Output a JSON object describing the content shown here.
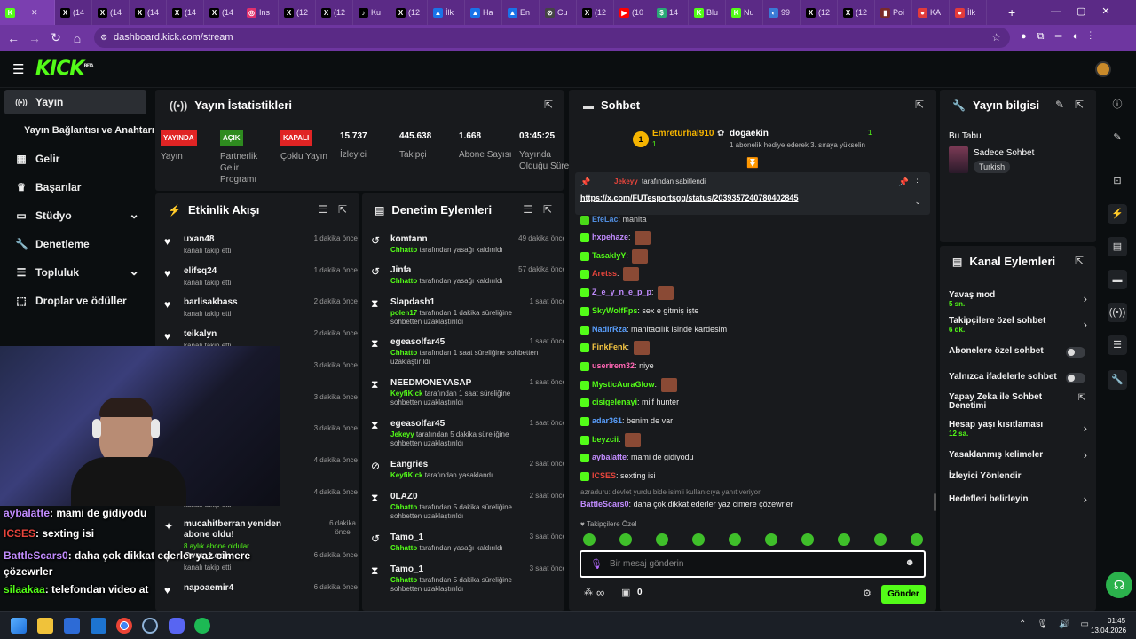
{
  "browser": {
    "tabs": [
      {
        "fav": "K",
        "color": "#53fc18",
        "label": ""
      },
      {
        "fav": "X",
        "color": "#000000",
        "label": "(14"
      },
      {
        "fav": "X",
        "color": "#000000",
        "label": "(14"
      },
      {
        "fav": "X",
        "color": "#000000",
        "label": "(14"
      },
      {
        "fav": "X",
        "color": "#000000",
        "label": "(14"
      },
      {
        "fav": "X",
        "color": "#000000",
        "label": "(14"
      },
      {
        "fav": "◎",
        "color": "#e1306c",
        "label": "Ins"
      },
      {
        "fav": "X",
        "color": "#000000",
        "label": "(12"
      },
      {
        "fav": "X",
        "color": "#000000",
        "label": "(12"
      },
      {
        "fav": "♪",
        "color": "#000000",
        "label": "Ku"
      },
      {
        "fav": "X",
        "color": "#000000",
        "label": "(12"
      },
      {
        "fav": "▲",
        "color": "#1a73e8",
        "label": "İlk"
      },
      {
        "fav": "▲",
        "color": "#1a73e8",
        "label": "Ha"
      },
      {
        "fav": "▲",
        "color": "#1a73e8",
        "label": "En"
      },
      {
        "fav": "⊘",
        "color": "#444444",
        "label": "Cu"
      },
      {
        "fav": "X",
        "color": "#000000",
        "label": "(12"
      },
      {
        "fav": "▶",
        "color": "#ff0000",
        "label": "(10"
      },
      {
        "fav": "$",
        "color": "#2aa876",
        "label": "14"
      },
      {
        "fav": "K",
        "color": "#53fc18",
        "label": "Blu"
      },
      {
        "fav": "K",
        "color": "#53fc18",
        "label": "Nu"
      },
      {
        "fav": "◐",
        "color": "#3a7bd5",
        "label": "99"
      },
      {
        "fav": "X",
        "color": "#000000",
        "label": "(12"
      },
      {
        "fav": "X",
        "color": "#000000",
        "label": "(12"
      },
      {
        "fav": "▮",
        "color": "#7a2a2a",
        "label": "Poi"
      },
      {
        "fav": "●",
        "color": "#e23b3b",
        "label": "KA"
      },
      {
        "fav": "●",
        "color": "#e23b3b",
        "label": "İlk"
      }
    ],
    "url": "dashboard.kick.com/stream"
  },
  "sidebar": {
    "items": [
      {
        "icon": "((•))",
        "label": "Yayın"
      },
      {
        "icon": "",
        "label": "Yayın Bağlantısı ve Anahtarı"
      },
      {
        "icon": "▦",
        "label": "Gelir"
      },
      {
        "icon": "♛",
        "label": "Başarılar"
      },
      {
        "icon": "▭",
        "label": "Stüdyo"
      },
      {
        "icon": "🔧",
        "label": "Denetleme"
      },
      {
        "icon": "☰",
        "label": "Topluluk"
      },
      {
        "icon": "⬚",
        "label": "Droplar ve ödüller"
      }
    ]
  },
  "stats": {
    "title": "Yayın İstatistikleri",
    "items": [
      {
        "badge": "YAYINDA",
        "badge_color": "#e02424",
        "label": "Yayın"
      },
      {
        "badge": "AÇIK",
        "badge_color": "#2e8b1f",
        "label": "Partnerlik Gelir Programı"
      },
      {
        "badge": "KAPALI",
        "badge_color": "#e02424",
        "label": "Çoklu Yayın"
      },
      {
        "value": "15.737",
        "label": "İzleyici"
      },
      {
        "value": "445.638",
        "label": "Takipçi"
      },
      {
        "value": "1.668",
        "label": "Abone Sayısı"
      },
      {
        "value": "03:45:25",
        "label": "Yayında Olduğu Süre"
      }
    ]
  },
  "activity": {
    "title": "Etkinlik Akışı",
    "rows": [
      {
        "name": "uxan48",
        "sub": "kanalı takip etti",
        "time": "1 dakika önce"
      },
      {
        "name": "elifsq24",
        "sub": "kanalı takip etti",
        "time": "1 dakika önce"
      },
      {
        "name": "barlisakbass",
        "sub": "kanalı takip etti",
        "time": "2 dakika önce"
      },
      {
        "name": "teikalyn",
        "sub": "kanalı takip etti",
        "time": "2 dakika önce"
      },
      {
        "name": "",
        "sub": "",
        "time": "3 dakika önce"
      },
      {
        "name": "",
        "sub": "",
        "time": "3 dakika önce"
      },
      {
        "name": "",
        "sub": "",
        "time": "3 dakika önce"
      },
      {
        "name": "",
        "sub": "",
        "time": "4 dakika önce"
      },
      {
        "name": "",
        "sub": "kanalı takip etti",
        "time": "4 dakika önce"
      },
      {
        "name": "mucahitberran yeniden abone oldu!",
        "sub": "8 aylık abone oldular",
        "time": "6 dakika önce"
      },
      {
        "name": "Over_Lock",
        "sub": "kanalı takip etti",
        "time": "6 dakika önce"
      },
      {
        "name": "napoaemir4",
        "sub": "",
        "time": "6 dakika önce"
      }
    ]
  },
  "moderation": {
    "title": "Denetim Eylemleri",
    "rows": [
      {
        "name": "komtann",
        "actor": "Chhatto",
        "sub": "tarafından yasağı kaldırıldı",
        "time": "49 dakika önce",
        "icon": "↺"
      },
      {
        "name": "Jinfa",
        "actor": "Chhatto",
        "sub": "tarafından yasağı kaldırıldı",
        "time": "57 dakika önce",
        "icon": "↺"
      },
      {
        "name": "Slapdash1",
        "actor": "polen17",
        "sub": "tarafından 1 dakika süreliğine sohbetten uzaklaştırıldı",
        "time": "1 saat önce",
        "icon": "⧗"
      },
      {
        "name": "egeasolfar45",
        "actor": "Chhatto",
        "sub": "tarafından 1 saat süreliğine sohbetten uzaklaştırıldı",
        "time": "1 saat önce",
        "icon": "⧗"
      },
      {
        "name": "NEEDMONEYASAP",
        "actor": "KeyfiKick",
        "sub": "tarafından 1 saat süreliğine sohbetten uzaklaştırıldı",
        "time": "1 saat önce",
        "icon": "⧗"
      },
      {
        "name": "egeasolfar45",
        "actor": "Jekeyy",
        "sub": "tarafından 5 dakika süreliğine sohbetten uzaklaştırıldı",
        "time": "1 saat önce",
        "icon": "⧗"
      },
      {
        "name": "Eangries",
        "actor": "KeyfiKick",
        "sub": "tarafından yasaklandı",
        "time": "2 saat önce",
        "icon": "⊘"
      },
      {
        "name": "0LAZ0",
        "actor": "Chhatto",
        "sub": "tarafından 5 dakika süreliğine sohbetten uzaklaştırıldı",
        "time": "2 saat önce",
        "icon": "⧗"
      },
      {
        "name": "Tamo_1",
        "actor": "Chhatto",
        "sub": "tarafından yasağı kaldırıldı",
        "time": "3 saat önce",
        "icon": "↺"
      },
      {
        "name": "Tamo_1",
        "actor": "Chhatto",
        "sub": "tarafından 5 dakika süreliğine sohbetten uzaklaştırıldı",
        "time": "3 saat önce",
        "icon": "⧗"
      }
    ]
  },
  "chat": {
    "title": "Sohbet",
    "top_gifter": {
      "rank": "1",
      "name": "Emreturhal910",
      "count": "1"
    },
    "gift_user": {
      "name": "dogaekin",
      "count": "1",
      "text": "1 abonelik hediye ederek 3. sıraya yükselin"
    },
    "pinned": {
      "by": "Jekeyy",
      "label": "tarafından sabitlendi",
      "url": "https://x.com/FUTesportsgg/status/2039357240780402845"
    },
    "messages": [
      {
        "user": "EfeLac",
        "color": "#5aa0ff",
        "text": "manita",
        "emote": false
      },
      {
        "user": "hxpehaze",
        "color": "#c28cff",
        "text": "",
        "emote": true
      },
      {
        "user": "TasaklyY",
        "color": "#53fc18",
        "text": "",
        "emote": true
      },
      {
        "user": "Aretss",
        "color": "#e8453c",
        "text": "",
        "emote": true
      },
      {
        "user": "Z_e_y_n_e_p_p",
        "color": "#c28cff",
        "text": "",
        "emote": true
      },
      {
        "user": "SkyWolfFps",
        "color": "#53fc18",
        "text": "sex e gitmiş işte",
        "emote": false
      },
      {
        "user": "NadirRza",
        "color": "#5aa0ff",
        "text": "manitacılık isinde kardesim",
        "emote": false
      },
      {
        "user": "FinkFenk",
        "color": "#f5c542",
        "text": "",
        "emote": true
      },
      {
        "user": "userirem32",
        "color": "#ff66b3",
        "text": "niye",
        "emote": false
      },
      {
        "user": "MysticAuraGlow",
        "color": "#53fc18",
        "text": "",
        "emote": true
      },
      {
        "user": "cisigelenayi",
        "color": "#53fc18",
        "text": "milf hunter",
        "emote": false
      },
      {
        "user": "adar361",
        "color": "#5aa0ff",
        "text": "benim de var",
        "emote": false
      },
      {
        "user": "beyzcii",
        "color": "#53fc18",
        "text": "",
        "emote": true
      },
      {
        "user": "aybalatte",
        "color": "#c28cff",
        "text": "mami de gidiyodu",
        "emote": false
      },
      {
        "user": "ICSES",
        "color": "#e8453c",
        "text": "sexting isi",
        "emote": false
      }
    ],
    "reply_hint": "azraduru: devlet yurdu bide isimli kullanıcıya yanıt veriyor",
    "last_msg": {
      "user": "BattleScars0",
      "color": "#c28cff",
      "text": "daha çok dikkat ederler yaz cimere çözewrler"
    },
    "followers_only": "Takipçilere Özel",
    "input_placeholder": "Bir mesaj gönderin",
    "send_label": "Gönder",
    "footer_infinity": "∞",
    "footer_count": "0"
  },
  "stream_info": {
    "title": "Yayın bilgisi",
    "tab_label": "Bu Tabu",
    "mode": "Sadece Sohbet",
    "language": "Turkish"
  },
  "channel_actions": {
    "title": "Kanal Eylemleri",
    "rows": [
      {
        "label": "Yavaş mod",
        "value": "5 sn.",
        "type": "chev"
      },
      {
        "label": "Takipçilere özel sohbet",
        "value": "6 dk.",
        "type": "chev"
      },
      {
        "label": "Abonelere özel sohbet",
        "value": "",
        "type": "toggle"
      },
      {
        "label": "Yalnızca ifadelerle sohbet",
        "value": "",
        "type": "toggle"
      },
      {
        "label": "Yapay Zeka ile Sohbet Denetimi",
        "value": "",
        "type": "ext"
      },
      {
        "label": "Hesap yaşı kısıtlaması",
        "value": "12 sa.",
        "type": "chev"
      },
      {
        "label": "Yasaklanmış kelimeler",
        "value": "",
        "type": "chev"
      },
      {
        "label": "İzleyici Yönlendir",
        "value": "",
        "type": "none"
      },
      {
        "label": "Hedefleri belirleyin",
        "value": "",
        "type": "chev"
      }
    ]
  },
  "overlay": {
    "lines": [
      {
        "user": "aybalatte",
        "color": "#c28cff",
        "text": ": mami de gidiyodu"
      },
      {
        "user": "ICSES",
        "color": "#e8453c",
        "text": ": sexting isi"
      },
      {
        "user": "BattleScars0",
        "color": "#c28cff",
        "text": ": daha çok dikkat ederler yaz cimere çözewrler"
      },
      {
        "user": "silaakaa",
        "color": "#53fc18",
        "text": ": telefondan video at"
      }
    ]
  },
  "taskbar": {
    "time": "01:45",
    "date": "13.04.2026"
  }
}
